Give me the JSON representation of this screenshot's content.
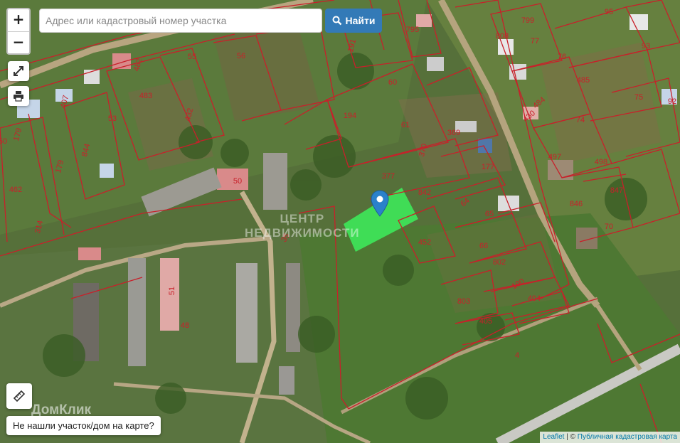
{
  "search": {
    "placeholder": "Адрес или кадастровый номер участка"
  },
  "buttons": {
    "find_label": "Найти",
    "zoom_in": "+",
    "zoom_out": "−",
    "not_found": "Не нашли участок/дом на карте?"
  },
  "attribution": {
    "leaflet": "Leaflet",
    "separator": " | © ",
    "source": "Публичная кадастровая карта"
  },
  "watermark": {
    "line1": "ЦЕНТР",
    "line2": "НЕДВИЖИМОСТИ"
  },
  "brand": "ДомКлик",
  "parcels": [
    "795",
    "799",
    "95",
    "808",
    "77",
    "93",
    "191",
    "55",
    "56",
    "482",
    "76",
    "485",
    "407",
    "483",
    "60",
    "75",
    "92",
    "484",
    "53",
    "432",
    "194",
    "430",
    "74",
    "61",
    "369",
    "179",
    "179",
    "844",
    "370",
    "497",
    "498",
    "50",
    "377",
    "177",
    "462",
    "842",
    "847",
    "50",
    "64",
    "846",
    "65",
    "70",
    "314",
    "35",
    "452",
    "66",
    "802",
    "190",
    "404",
    "51",
    "803",
    "48",
    "405",
    "4"
  ],
  "colors": {
    "accent": "#337ab7",
    "parcel_line": "#c8202a",
    "selected_parcel": "#3ee85a",
    "marker": "#2a81cb"
  }
}
